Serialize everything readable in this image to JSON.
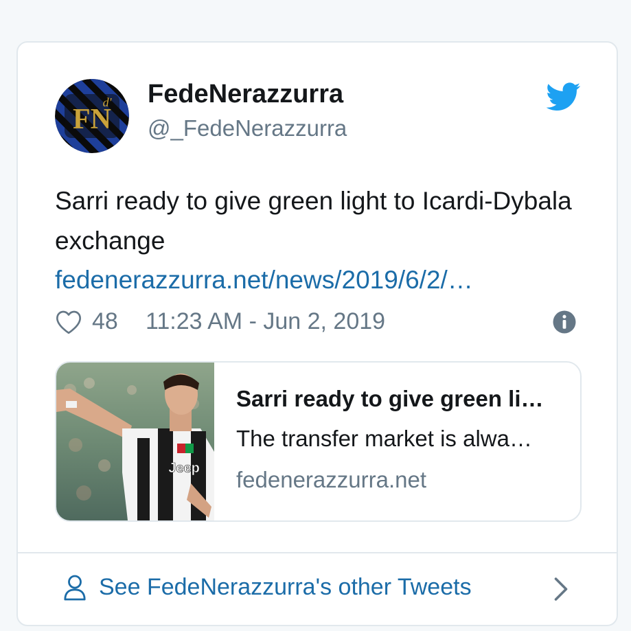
{
  "tweet": {
    "author": {
      "display_name": "FedeNerazzurra",
      "handle": "@_FedeNerazzurra",
      "avatar_monogram": "FN",
      "avatar_accent": "d'"
    },
    "text": "Sarri ready to give green light to Icardi-Dybala exchange",
    "link": "fedenerazzurra.net/news/2019/6/2/…",
    "likes": "48",
    "timestamp": "11:23 AM - Jun 2, 2019",
    "icons": {
      "brand": "twitter-bird-icon",
      "like": "heart-icon",
      "info": "info-icon"
    }
  },
  "link_card": {
    "title": "Sarri ready to give green li…",
    "description": "The transfer market is alwa…",
    "domain": "fedenerazzurra.net",
    "thumbnail_jersey_text": "Jeep"
  },
  "footer": {
    "label": "See FedeNerazzurra's other Tweets",
    "icons": {
      "profile": "person-icon",
      "chevron": "chevron-right-icon"
    }
  },
  "colors": {
    "brand_blue": "#1da1f2",
    "link_blue": "#1b6ca8",
    "text_primary": "#14171a",
    "text_secondary": "#657786",
    "border": "#e1e8ed",
    "page_bg": "#f5f8fa"
  }
}
